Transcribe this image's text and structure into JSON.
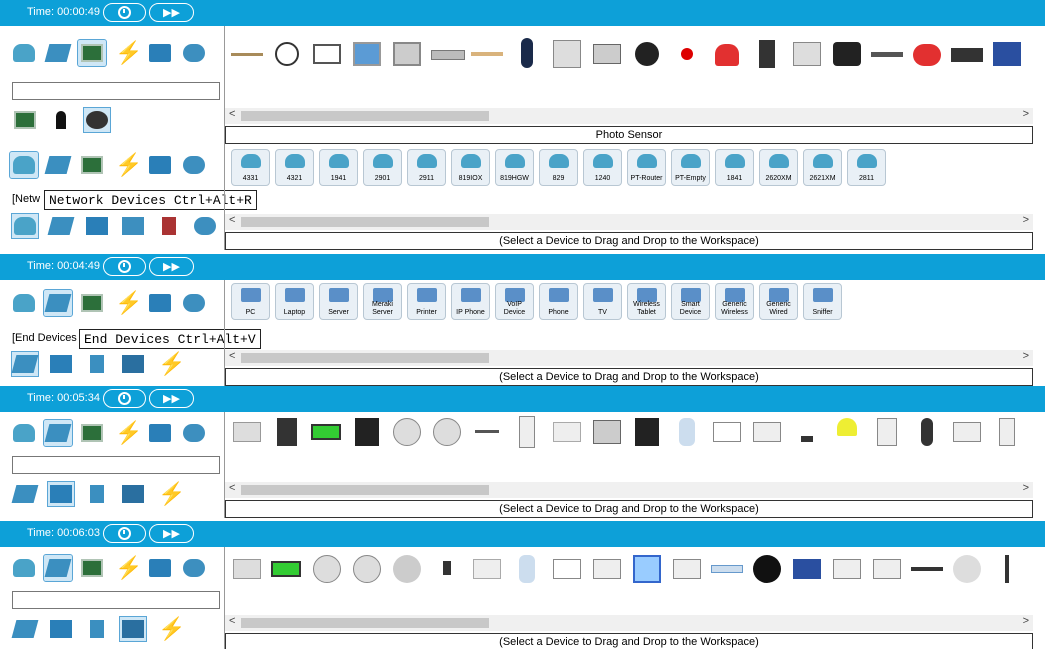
{
  "panels": [
    {
      "time": "Time: 00:00:49",
      "status": "Photo Sensor"
    },
    {
      "status": "(Select a Device to Drag and Drop to the Workspace)",
      "tag": "[Netw",
      "tooltip": "Network Devices Ctrl+Alt+R",
      "devices": [
        "4331",
        "4321",
        "1941",
        "2901",
        "2911",
        "819IOX",
        "819HGW",
        "829",
        "1240",
        "PT-Router",
        "PT-Empty",
        "1841",
        "2620XM",
        "2621XM",
        "2811"
      ]
    },
    {
      "time": "Time: 00:04:49",
      "status": "(Select a Device to Drag and Drop to the Workspace)",
      "tag": "[End Devices",
      "tooltip": "End Devices Ctrl+Alt+V",
      "devices": [
        "PC",
        "Laptop",
        "Server",
        "Meraki Server",
        "Printer",
        "IP Phone",
        "VoIP Device",
        "Phone",
        "TV",
        "Wireless Tablet",
        "Smart Device",
        "Generic Wireless",
        "Generic Wired",
        "Sniffer"
      ]
    },
    {
      "time": "Time: 00:05:34",
      "status": "(Select a Device to Drag and Drop to the Workspace)"
    },
    {
      "time": "Time: 00:06:03",
      "status": "(Select a Device to Drag and Drop to the Workspace)"
    }
  ],
  "colors": {
    "bar": "#0da0d8"
  }
}
